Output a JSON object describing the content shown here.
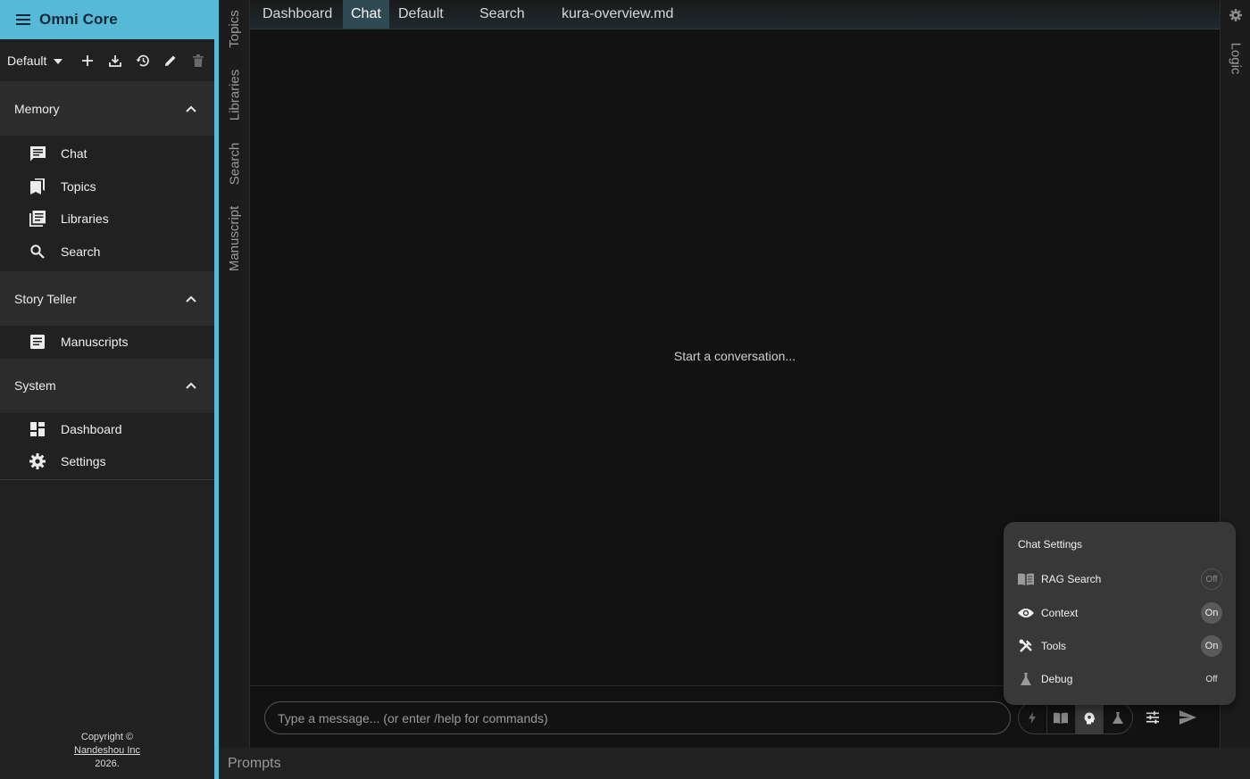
{
  "app": {
    "title": "Omni Core"
  },
  "toolbar": {
    "preset": "Default"
  },
  "sections": [
    {
      "title": "Memory",
      "items": [
        {
          "label": "Chat",
          "icon": "chat-icon"
        },
        {
          "label": "Topics",
          "icon": "bookmarks-icon"
        },
        {
          "label": "Libraries",
          "icon": "library-icon"
        },
        {
          "label": "Search",
          "icon": "search-icon"
        }
      ]
    },
    {
      "title": "Story Teller",
      "items": [
        {
          "label": "Manuscripts",
          "icon": "article-icon"
        }
      ]
    },
    {
      "title": "System",
      "items": [
        {
          "label": "Dashboard",
          "icon": "dashboard-icon"
        },
        {
          "label": "Settings",
          "icon": "settings-icon"
        }
      ]
    }
  ],
  "footer": {
    "line1": "Copyright ©",
    "company": "Nandeshou Inc",
    "year": "2026."
  },
  "vertical_tabs": [
    "Topics",
    "Libraries",
    "Search",
    "Manuscript"
  ],
  "top_tabs": [
    {
      "label": "Dashboard",
      "active": false
    },
    {
      "label": "Chat",
      "active": true
    },
    {
      "label": "Default",
      "active": false
    },
    {
      "label": "Search",
      "active": false
    },
    {
      "label": "kura-overview.md",
      "active": false
    }
  ],
  "right_panel": {
    "label": "Logic"
  },
  "chat": {
    "empty_message": "Start a conversation...",
    "input_placeholder": "Type a message... (or enter /help for commands)"
  },
  "chat_settings": {
    "title": "Chat Settings",
    "rows": [
      {
        "label": "RAG Search",
        "state": "Off",
        "icon": "menu-book-icon"
      },
      {
        "label": "Context",
        "state": "On",
        "icon": "eye-icon"
      },
      {
        "label": "Tools",
        "state": "On",
        "icon": "tools-icon"
      },
      {
        "label": "Debug",
        "state": "Off",
        "icon": "flask-icon"
      }
    ]
  },
  "bottom": {
    "prompts_label": "Prompts"
  },
  "colors": {
    "accent": "#56b9d6",
    "active_tab": "#2f4a52",
    "background": "#121212",
    "sidebar": "#212121"
  }
}
